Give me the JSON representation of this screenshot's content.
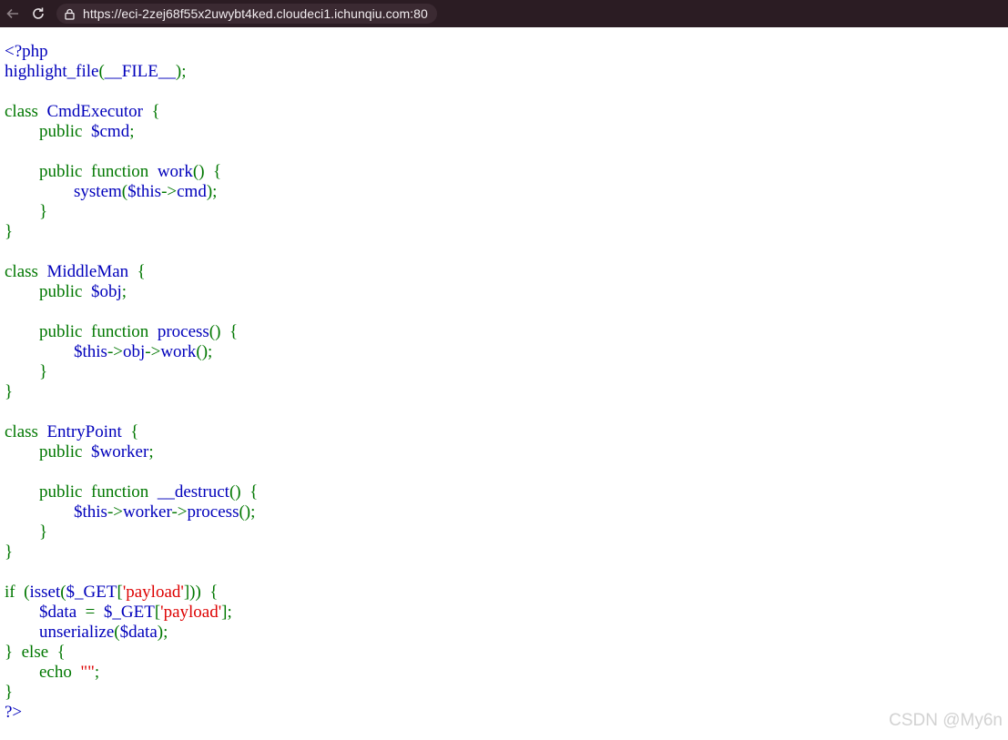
{
  "browser": {
    "url": "https://eci-2zej68f55x2uwybt4ked.cloudeci1.ichunqiu.com:80"
  },
  "code": {
    "l1": [
      {
        "t": "<?php",
        "c": "d"
      }
    ],
    "l2": [
      {
        "t": "highlight_file",
        "c": "d"
      },
      {
        "t": "(",
        "c": "k"
      },
      {
        "t": "__FILE__",
        "c": "d"
      },
      {
        "t": ");",
        "c": "k"
      }
    ],
    "l3": [],
    "l4": [
      {
        "t": "class  ",
        "c": "k"
      },
      {
        "t": "CmdExecutor  ",
        "c": "d"
      },
      {
        "t": "{",
        "c": "k"
      }
    ],
    "l5": [
      {
        "t": "        public  ",
        "c": "k"
      },
      {
        "t": "$cmd",
        "c": "d"
      },
      {
        "t": ";",
        "c": "k"
      }
    ],
    "l6": [],
    "l7": [
      {
        "t": "        public  function  ",
        "c": "k"
      },
      {
        "t": "work",
        "c": "d"
      },
      {
        "t": "()  {",
        "c": "k"
      }
    ],
    "l8": [
      {
        "t": "                ",
        "c": "k"
      },
      {
        "t": "system",
        "c": "d"
      },
      {
        "t": "(",
        "c": "k"
      },
      {
        "t": "$this",
        "c": "d"
      },
      {
        "t": "->",
        "c": "k"
      },
      {
        "t": "cmd",
        "c": "d"
      },
      {
        "t": ");",
        "c": "k"
      }
    ],
    "l9": [
      {
        "t": "        }",
        "c": "k"
      }
    ],
    "l10": [
      {
        "t": "}",
        "c": "k"
      }
    ],
    "l11": [],
    "l12": [
      {
        "t": "class  ",
        "c": "k"
      },
      {
        "t": "MiddleMan  ",
        "c": "d"
      },
      {
        "t": "{",
        "c": "k"
      }
    ],
    "l13": [
      {
        "t": "        public  ",
        "c": "k"
      },
      {
        "t": "$obj",
        "c": "d"
      },
      {
        "t": ";",
        "c": "k"
      }
    ],
    "l14": [],
    "l15": [
      {
        "t": "        public  function  ",
        "c": "k"
      },
      {
        "t": "process",
        "c": "d"
      },
      {
        "t": "()  {",
        "c": "k"
      }
    ],
    "l16": [
      {
        "t": "                ",
        "c": "k"
      },
      {
        "t": "$this",
        "c": "d"
      },
      {
        "t": "->",
        "c": "k"
      },
      {
        "t": "obj",
        "c": "d"
      },
      {
        "t": "->",
        "c": "k"
      },
      {
        "t": "work",
        "c": "d"
      },
      {
        "t": "();",
        "c": "k"
      }
    ],
    "l17": [
      {
        "t": "        }",
        "c": "k"
      }
    ],
    "l18": [
      {
        "t": "}",
        "c": "k"
      }
    ],
    "l19": [],
    "l20": [
      {
        "t": "class  ",
        "c": "k"
      },
      {
        "t": "EntryPoint  ",
        "c": "d"
      },
      {
        "t": "{",
        "c": "k"
      }
    ],
    "l21": [
      {
        "t": "        public  ",
        "c": "k"
      },
      {
        "t": "$worker",
        "c": "d"
      },
      {
        "t": ";",
        "c": "k"
      }
    ],
    "l22": [],
    "l23": [
      {
        "t": "        public  function  ",
        "c": "k"
      },
      {
        "t": "__destruct",
        "c": "d"
      },
      {
        "t": "()  {",
        "c": "k"
      }
    ],
    "l24": [
      {
        "t": "                ",
        "c": "k"
      },
      {
        "t": "$this",
        "c": "d"
      },
      {
        "t": "->",
        "c": "k"
      },
      {
        "t": "worker",
        "c": "d"
      },
      {
        "t": "->",
        "c": "k"
      },
      {
        "t": "process",
        "c": "d"
      },
      {
        "t": "();",
        "c": "k"
      }
    ],
    "l25": [
      {
        "t": "        }",
        "c": "k"
      }
    ],
    "l26": [
      {
        "t": "}",
        "c": "k"
      }
    ],
    "l27": [],
    "l28": [
      {
        "t": "if  (",
        "c": "k"
      },
      {
        "t": "isset",
        "c": "d"
      },
      {
        "t": "(",
        "c": "k"
      },
      {
        "t": "$_GET",
        "c": "d"
      },
      {
        "t": "[",
        "c": "k"
      },
      {
        "t": "'payload'",
        "c": "s"
      },
      {
        "t": "]))  {",
        "c": "k"
      }
    ],
    "l29": [
      {
        "t": "        ",
        "c": "k"
      },
      {
        "t": "$data  ",
        "c": "d"
      },
      {
        "t": "=  ",
        "c": "k"
      },
      {
        "t": "$_GET",
        "c": "d"
      },
      {
        "t": "[",
        "c": "k"
      },
      {
        "t": "'payload'",
        "c": "s"
      },
      {
        "t": "];",
        "c": "k"
      }
    ],
    "l30": [
      {
        "t": "        ",
        "c": "k"
      },
      {
        "t": "unserialize",
        "c": "d"
      },
      {
        "t": "(",
        "c": "k"
      },
      {
        "t": "$data",
        "c": "d"
      },
      {
        "t": ");",
        "c": "k"
      }
    ],
    "l31": [
      {
        "t": "}  else  {",
        "c": "k"
      }
    ],
    "l32": [
      {
        "t": "        echo  ",
        "c": "k"
      },
      {
        "t": "\"\"",
        "c": "s"
      },
      {
        "t": ";",
        "c": "k"
      }
    ],
    "l33": [
      {
        "t": "}",
        "c": "k"
      }
    ],
    "l34": [
      {
        "t": "?>",
        "c": "d"
      }
    ]
  },
  "watermark": "CSDN @My6n",
  "colors": {
    "keyword": "#007700",
    "default": "#0000bb",
    "string": "#dd0000",
    "topbar": "#2b1c23"
  }
}
